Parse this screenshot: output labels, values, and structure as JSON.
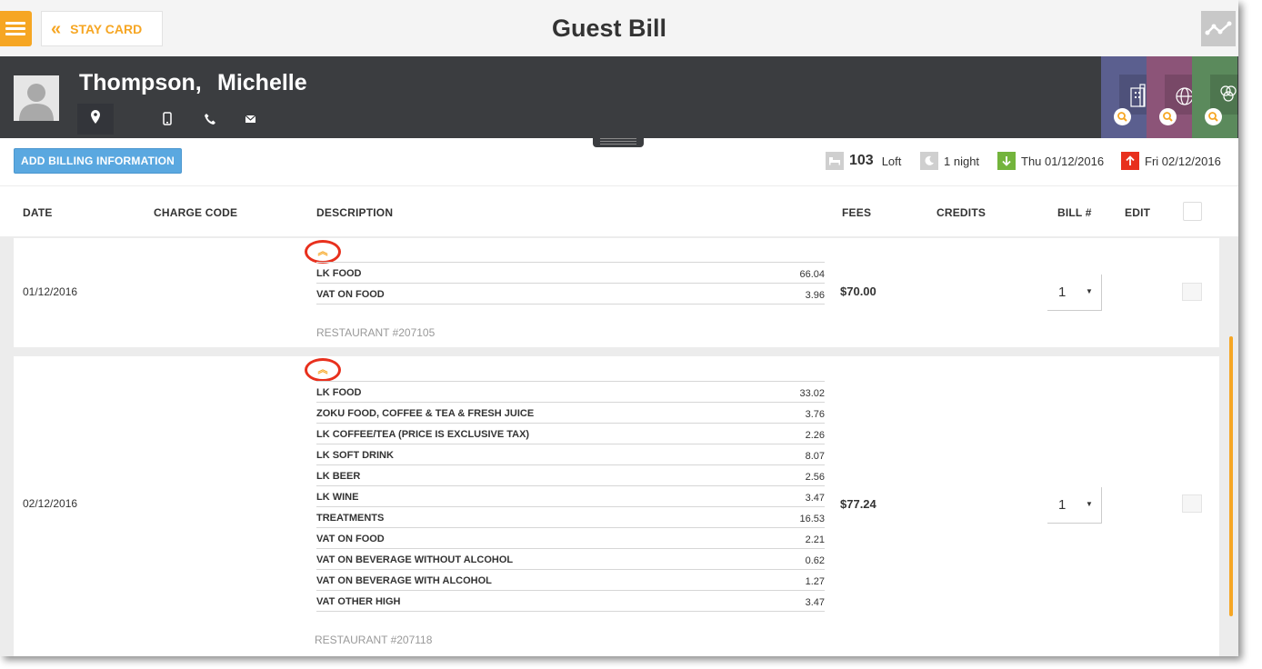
{
  "header": {
    "title": "Guest Bill",
    "back_label": "STAY CARD"
  },
  "guest": {
    "last_name": "Thompson,",
    "first_name": "Michelle"
  },
  "tab_colors": [
    "#5b5f8f",
    "#8c5478",
    "#5b8a5c"
  ],
  "actions": {
    "add_billing": "ADD BILLING INFORMATION"
  },
  "stay": {
    "room_number": "103",
    "room_type": "Loft",
    "nights": "1 night",
    "arrival": "Thu 01/12/2016",
    "departure": "Fri 02/12/2016",
    "arrival_color": "#73b43c",
    "departure_color": "#e8301d"
  },
  "table": {
    "columns": {
      "date": "DATE",
      "charge_code": "CHARGE CODE",
      "description": "DESCRIPTION",
      "fees": "FEES",
      "credits": "CREDITS",
      "bill": "BILL #",
      "edit": "EDIT"
    },
    "rows": [
      {
        "date": "01/12/2016",
        "fees": "$70.00",
        "bill": "1",
        "reference": "RESTAURANT #207105",
        "items": [
          {
            "name": "LK FOOD",
            "value": "66.04"
          },
          {
            "name": "VAT ON FOOD",
            "value": "3.96"
          }
        ]
      },
      {
        "date": "02/12/2016",
        "fees": "$77.24",
        "bill": "1",
        "reference": "RESTAURANT #207118",
        "items": [
          {
            "name": "LK FOOD",
            "value": "33.02"
          },
          {
            "name": "ZOKU FOOD, COFFEE & TEA & FRESH JUICE",
            "value": "3.76"
          },
          {
            "name": "LK COFFEE/TEA (PRICE IS EXCLUSIVE TAX)",
            "value": "2.26"
          },
          {
            "name": "LK SOFT DRINK",
            "value": "8.07"
          },
          {
            "name": "LK BEER",
            "value": "2.56"
          },
          {
            "name": "LK WINE",
            "value": "3.47"
          },
          {
            "name": "TREATMENTS",
            "value": "16.53"
          },
          {
            "name": "VAT ON FOOD",
            "value": "2.21"
          },
          {
            "name": "VAT ON BEVERAGE WITHOUT ALCOHOL",
            "value": "0.62"
          },
          {
            "name": "VAT ON BEVERAGE WITH ALCOHOL",
            "value": "1.27"
          },
          {
            "name": "VAT OTHER HIGH",
            "value": "3.47"
          }
        ]
      }
    ]
  },
  "icons": [
    "menu-icon",
    "chevron-double-left-icon",
    "graph-icon",
    "avatar-icon",
    "location-icon",
    "mobile-icon",
    "phone-icon",
    "email-icon",
    "company-card-icon",
    "travel-agent-icon",
    "group-icon",
    "search-icon",
    "bed-icon",
    "moon-icon",
    "arrival-arrow-icon",
    "departure-arrow-icon",
    "collapse-chevron-icon",
    "caret-down-icon"
  ]
}
